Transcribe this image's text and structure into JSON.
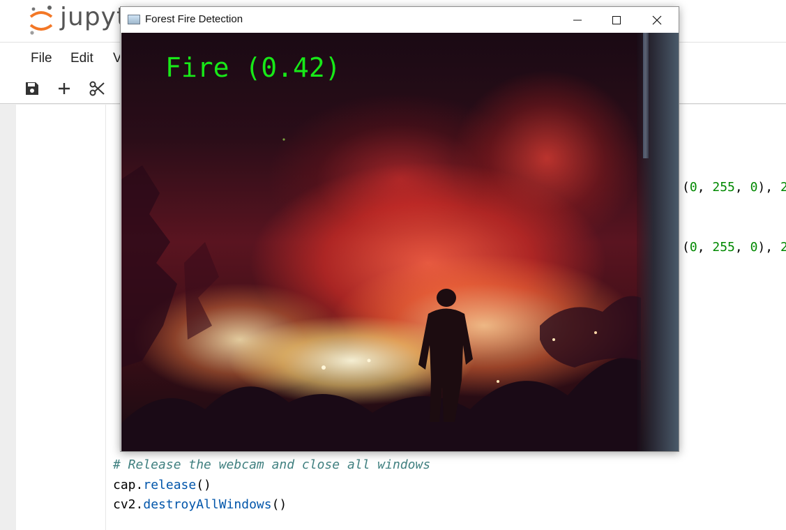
{
  "jupyter": {
    "logo_text": "jupyt",
    "menu": [
      "File",
      "Edit",
      "V"
    ],
    "toolbar_icons": [
      "save-icon",
      "plus-icon",
      "scissors-icon"
    ]
  },
  "notebook": {
    "partial_code_1": "(0, 255, 0), 2",
    "partial_code_2": "(0, 255, 0), 2",
    "comment_line": "# Release the webcam and close all windows",
    "line_cap_obj": "cap",
    "line_cap_fn": "release",
    "line_cap_parens": "()",
    "line_cv2_obj": "cv2",
    "line_cv2_fn": "destroyAllWindows",
    "line_cv2_parens": "()"
  },
  "cv_window": {
    "title": "Forest Fire Detection",
    "controls": [
      "minimize-icon",
      "maximize-icon",
      "close-icon"
    ],
    "overlay_label": "Fire (0.42)"
  },
  "colors": {
    "overlay_green": "#18e818",
    "code_number_green": "#008800",
    "code_function_blue": "#0055aa",
    "code_comment": "#408080",
    "logo_orange": "#f37726"
  }
}
